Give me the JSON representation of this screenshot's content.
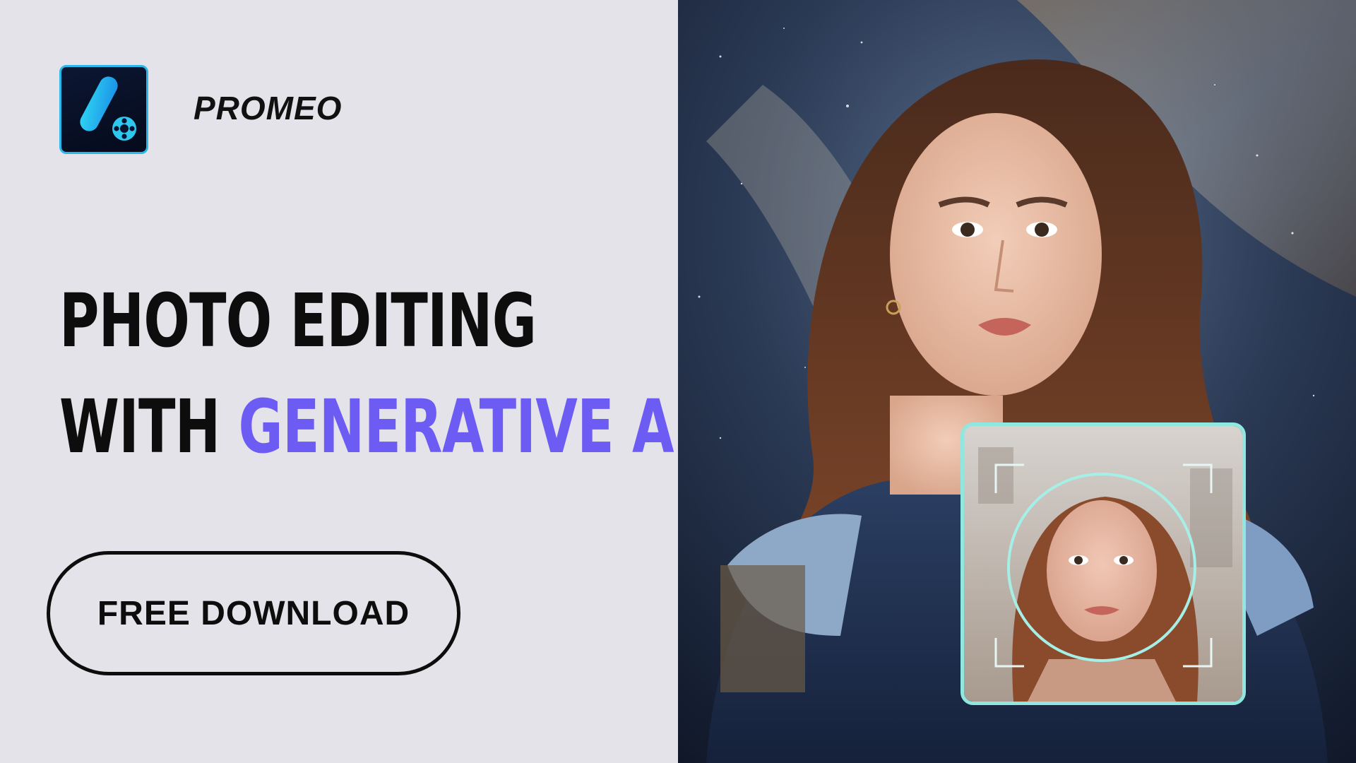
{
  "brand": {
    "name": "PROMEO",
    "logo_icon": "promeo-app-icon"
  },
  "headline": {
    "line1": "PHOTO EDITING",
    "line2_prefix": "WITH ",
    "line2_accent": "GENERATIVE AI"
  },
  "cta": {
    "label": "FREE DOWNLOAD"
  },
  "colors": {
    "background": "#e4e3e9",
    "accent": "#6d5cf3",
    "text": "#0d0d0d",
    "logo_border": "#2ab7ea",
    "scan_frame": "#8fe7df"
  },
  "hero": {
    "image": "ai-portrait-woman-in-space-suit-galaxy-background",
    "inset": "face-scan-source-photo"
  }
}
